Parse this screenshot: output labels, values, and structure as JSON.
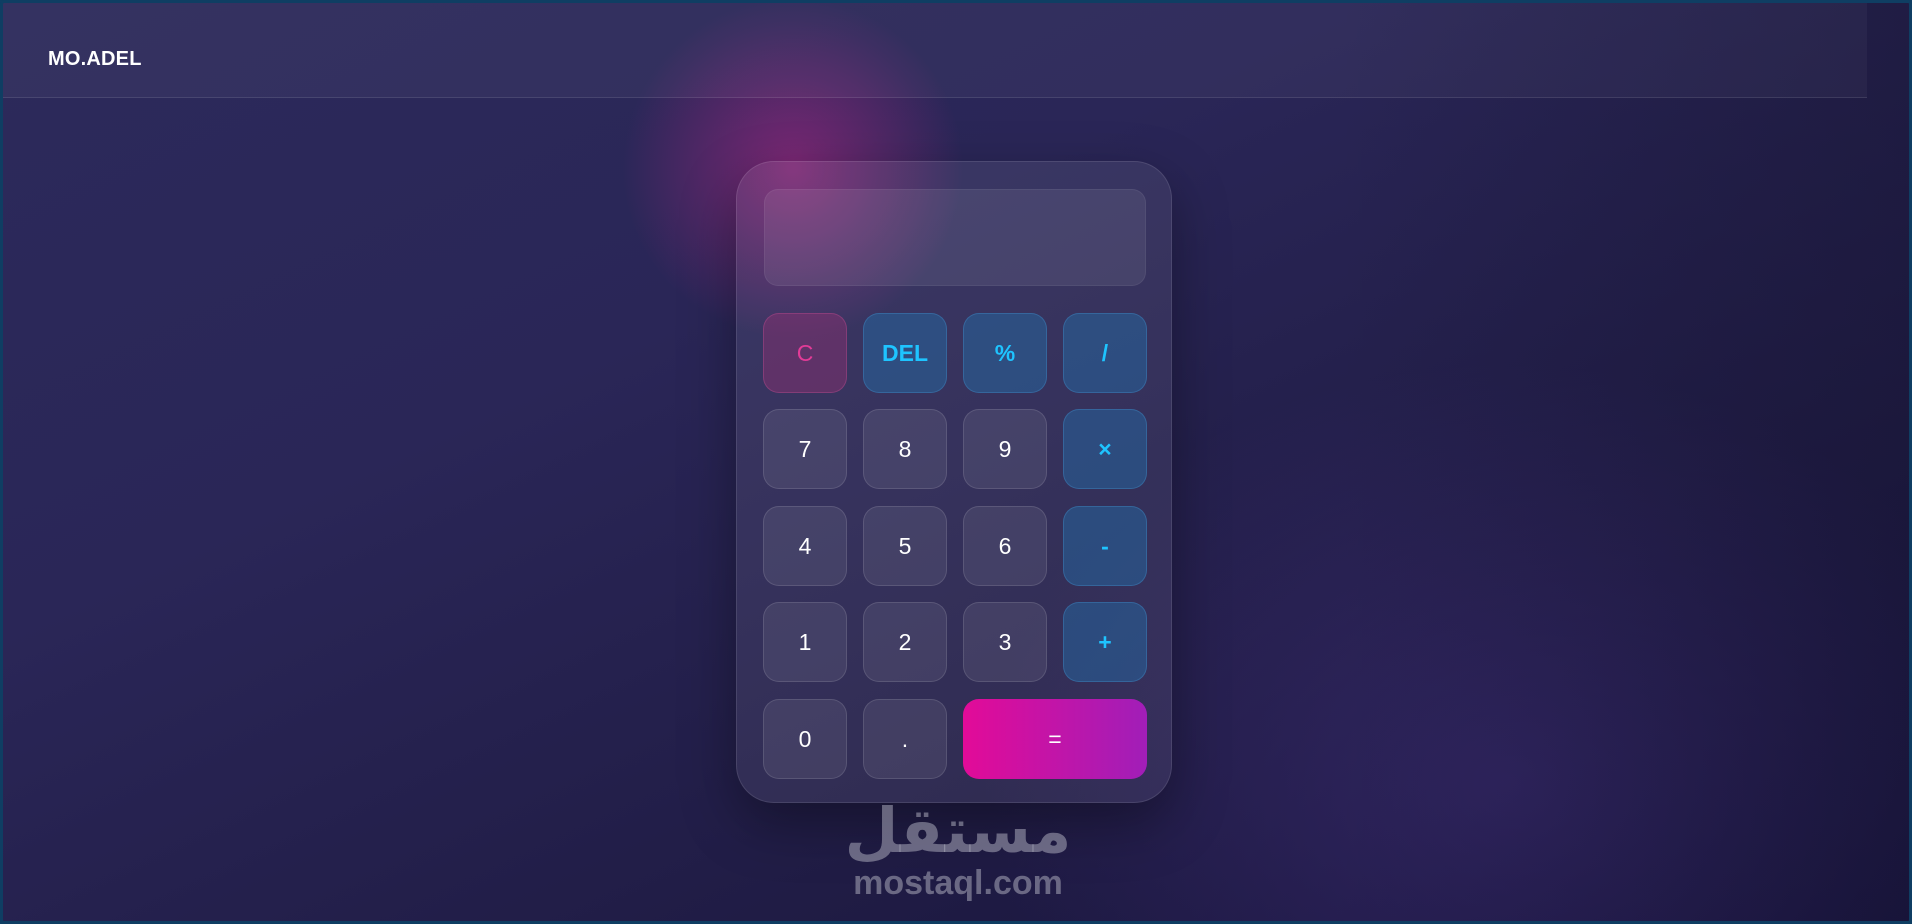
{
  "navbar": {
    "brand": "MO.ADEL"
  },
  "calculator": {
    "display_value": "",
    "keys": {
      "clear": "C",
      "delete": "DEL",
      "percent": "%",
      "divide": "/",
      "seven": "7",
      "eight": "8",
      "nine": "9",
      "multiply": "×",
      "four": "4",
      "five": "5",
      "six": "6",
      "subtract": "-",
      "one": "1",
      "two": "2",
      "three": "3",
      "add": "+",
      "zero": "0",
      "decimal": ".",
      "equals": "="
    }
  },
  "watermark": {
    "arabic": "مستقل",
    "latin": "mostaql.com"
  },
  "colors": {
    "operator_text": "#1ec4ff",
    "clear_text": "#e23b97",
    "equals_gradient_start": "#e20b98",
    "equals_gradient_end": "#a11eb8"
  }
}
